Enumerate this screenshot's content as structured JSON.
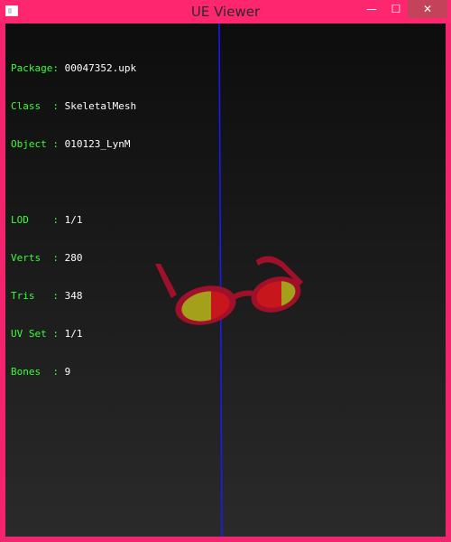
{
  "window": {
    "title": "UE Viewer",
    "min_glyph": "—",
    "max_glyph": "☐",
    "close_glyph": "✕"
  },
  "info": {
    "package_label": "Package:",
    "package_value": "00047352.upk",
    "class_label": "Class  :",
    "class_value": "SkeletalMesh",
    "object_label": "Object :",
    "object_value": "010123_LynM",
    "lod_label": "LOD    :",
    "lod_value": "1/1",
    "verts_label": "Verts  :",
    "verts_value": "280",
    "tris_label": "Tris   :",
    "tris_value": "348",
    "uvset_label": "UV Set :",
    "uvset_value": "1/1",
    "bones_label": "Bones  :",
    "bones_value": "9"
  },
  "colors": {
    "border": "#ff2670",
    "info_key": "#36ff36",
    "info_value": "#ffffff",
    "axis": "#1a1aff",
    "frame": "#a0102a",
    "lens_red": "#c8161d",
    "lens_yellow": "#a4a01c"
  }
}
